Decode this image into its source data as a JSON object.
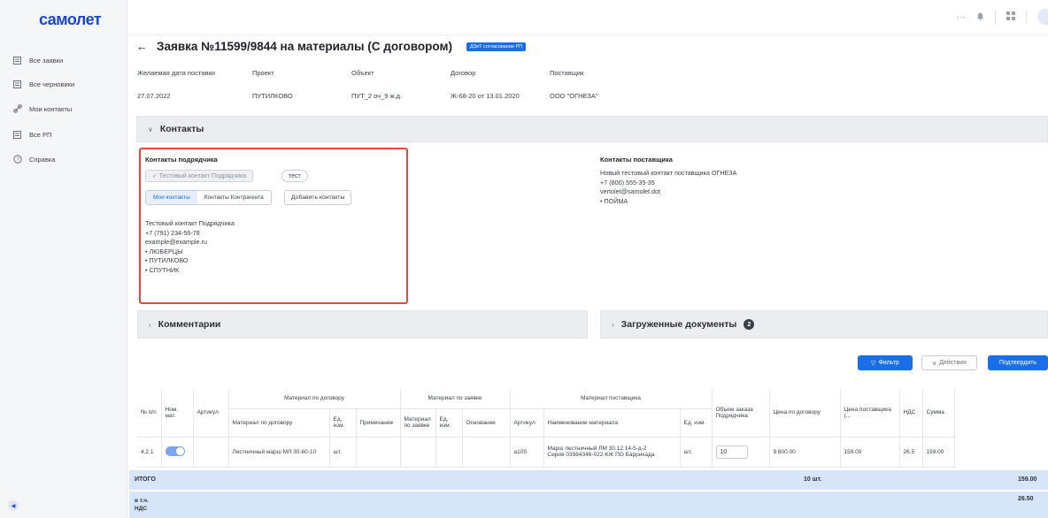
{
  "app": {
    "logo": "самолет"
  },
  "sidebar": {
    "items": [
      {
        "label": "Все заявки",
        "icon": "list-icon"
      },
      {
        "label": "Все черновики",
        "icon": "list-icon"
      },
      {
        "label": "Мои контакты",
        "icon": "link-icon"
      },
      {
        "label": "Все РП",
        "icon": "list-icon"
      },
      {
        "label": "Справка",
        "icon": "help-icon"
      }
    ]
  },
  "header": {
    "title": "Заявка №11599/9844 на материалы (С договором)",
    "status": "ДЗиТ согласование РП"
  },
  "meta": {
    "labels": [
      "Желаемая дата поставки",
      "Проект",
      "Объект",
      "Договор",
      "Поставщик"
    ],
    "values": [
      "27.07.2022",
      "ПУТИЛКОВО",
      "ПУТ_2 оч_9 ж.д.",
      "Ж-68-20 от 13.01.2020",
      "ООО \"ОГНЕЗА\""
    ]
  },
  "contacts": {
    "section_title": "Контакты",
    "contractor_title": "Контакты подрядчика",
    "chips": [
      "✓ Тестовый контакт Подрядчика",
      "тест"
    ],
    "tabs": [
      "Мои контакты",
      "Контакты Контрагента"
    ],
    "add_button": "Добавить контакты",
    "contractor_lines": [
      "Тестовый контакт Подрядчика",
      "+7 (791) 234-56-78",
      "example@example.ru",
      "• ЛЮБЕРЦЫ",
      "• ПУТИЛКОВО",
      "• СПУТНИК"
    ],
    "supplier_title": "Контакты поставщика",
    "supplier_lines": [
      "Новый тестовый контакт поставщика ОГНЕЗА",
      "+7 (800) 555-35-35",
      "vertolet@samolet.dot",
      "• ПОЙМА"
    ]
  },
  "comments": {
    "title": "Комментарии"
  },
  "documents": {
    "title": "Загруженные документы",
    "count": "2"
  },
  "actions": {
    "filter": "Фильтр",
    "actions": "Действия",
    "confirm": "Подтвердить"
  },
  "table": {
    "group_headers": [
      "Материал по договору",
      "Материал по заявке",
      "Материал поставщика"
    ],
    "headers": {
      "num": "№ п/п",
      "nom": "Ном. мат.",
      "article": "Артикул",
      "contract_material": "Материал по договору",
      "unit": "Ед. изм.",
      "note": "Примечание",
      "req_material": "Материал по заявке",
      "req_unit": "Ед. изм.",
      "reason": "Основание",
      "sup_article": "Артикул",
      "sup_name": "Наименование материала",
      "sup_unit": "Ед. изм.",
      "order_volume": "Объем заказа Подрядчика",
      "contract_price": "Цена по договору",
      "supplier_price": "Цена поставщика (...",
      "vat": "НДС",
      "sum": "Сумма"
    },
    "row": {
      "num": "4.2.1",
      "contract_material": "Лестничный марш МЛ 30-60-10",
      "unit": "шт.",
      "sup_article": "a105",
      "sup_name_1": "Марш лестничный ЛМ 30.12.14-5-д-2",
      "sup_name_2": "Серия 03984346-022-КЖ ПО Баррикада",
      "sup_unit": "шт.",
      "qty": "10",
      "contract_price": "9 800.00",
      "supplier_price": "159.00",
      "vat": "26.5",
      "sum": "159.00"
    },
    "total_label": "ИТОГО",
    "total_qty": "10 шт.",
    "total_sum": "159.00",
    "vat_label_1": "в т.ч.",
    "vat_label_2": "НДС",
    "vat_sum": "26.50"
  }
}
